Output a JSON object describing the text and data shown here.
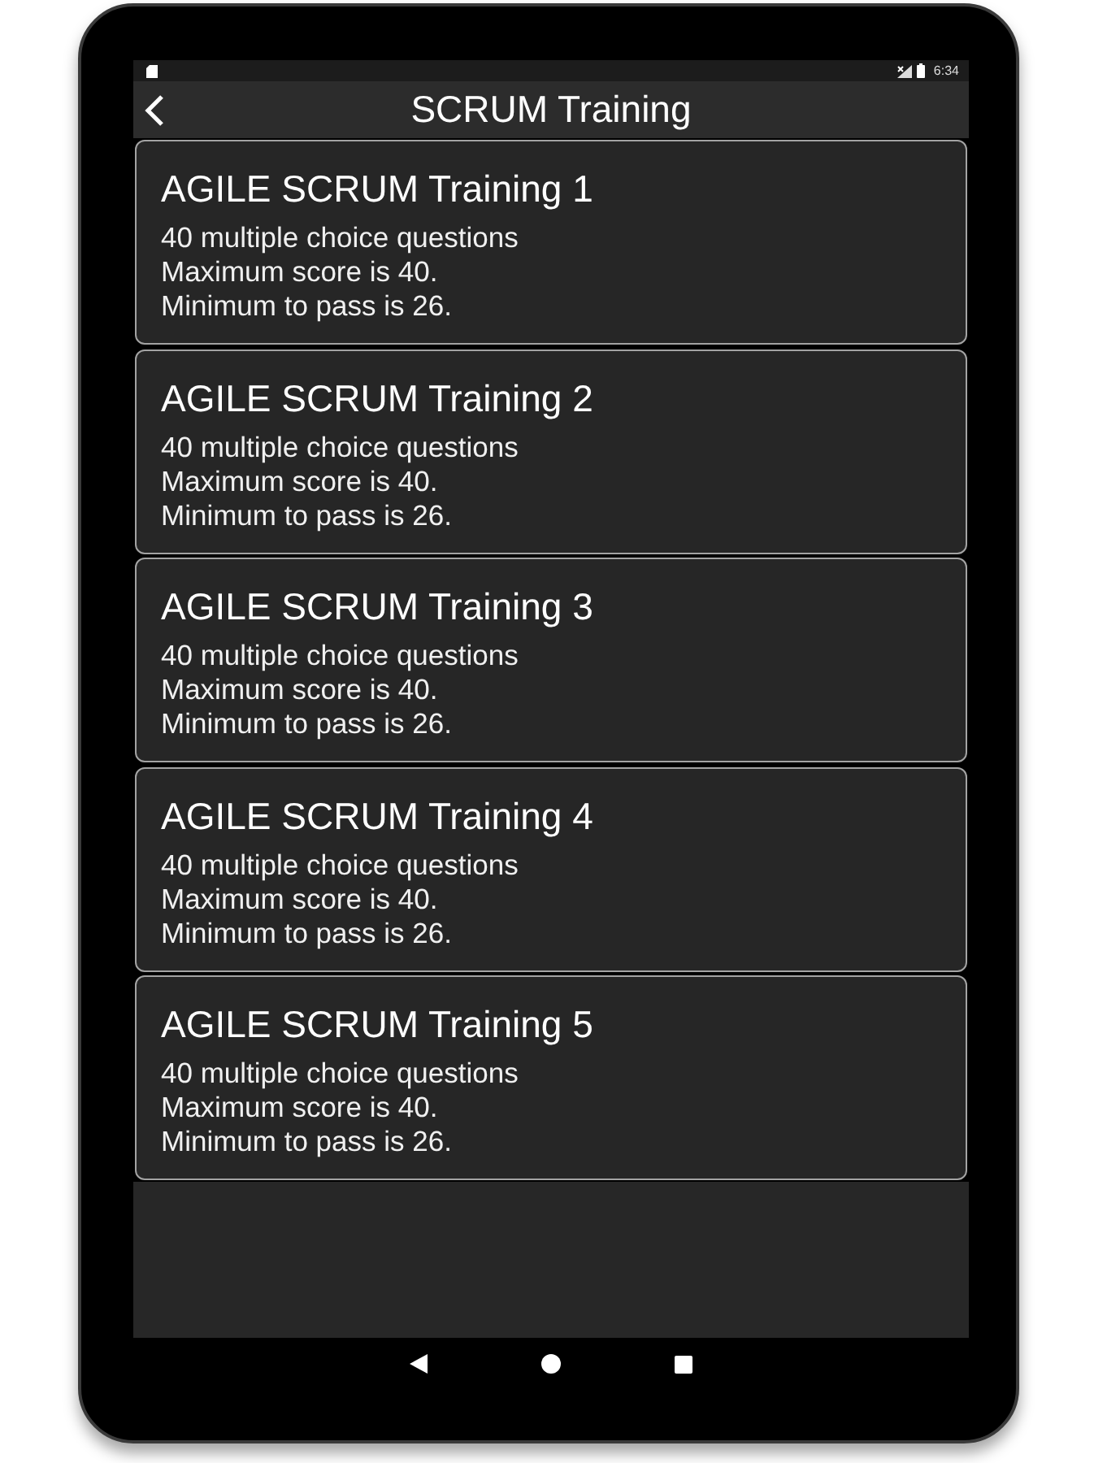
{
  "status_bar": {
    "time": "6:34"
  },
  "app_bar": {
    "title": "SCRUM Training"
  },
  "quizzes": [
    {
      "title": "AGILE SCRUM Training 1",
      "lines": [
        "40 multiple choice questions",
        "Maximum score is 40.",
        "Minimum to pass is 26."
      ]
    },
    {
      "title": "AGILE SCRUM Training 2",
      "lines": [
        "40 multiple choice questions",
        "Maximum score is 40.",
        "Minimum to pass is 26."
      ]
    },
    {
      "title": "AGILE SCRUM Training 3",
      "lines": [
        "40 multiple choice questions",
        "Maximum score is 40.",
        "Minimum to pass is 26."
      ]
    },
    {
      "title": "AGILE SCRUM Training 4",
      "lines": [
        "40 multiple choice questions",
        "Maximum score is 40.",
        "Minimum to pass is 26."
      ]
    },
    {
      "title": "AGILE SCRUM Training 5",
      "lines": [
        "40 multiple choice questions",
        "Maximum score is 40.",
        "Minimum to pass is 26."
      ]
    }
  ]
}
